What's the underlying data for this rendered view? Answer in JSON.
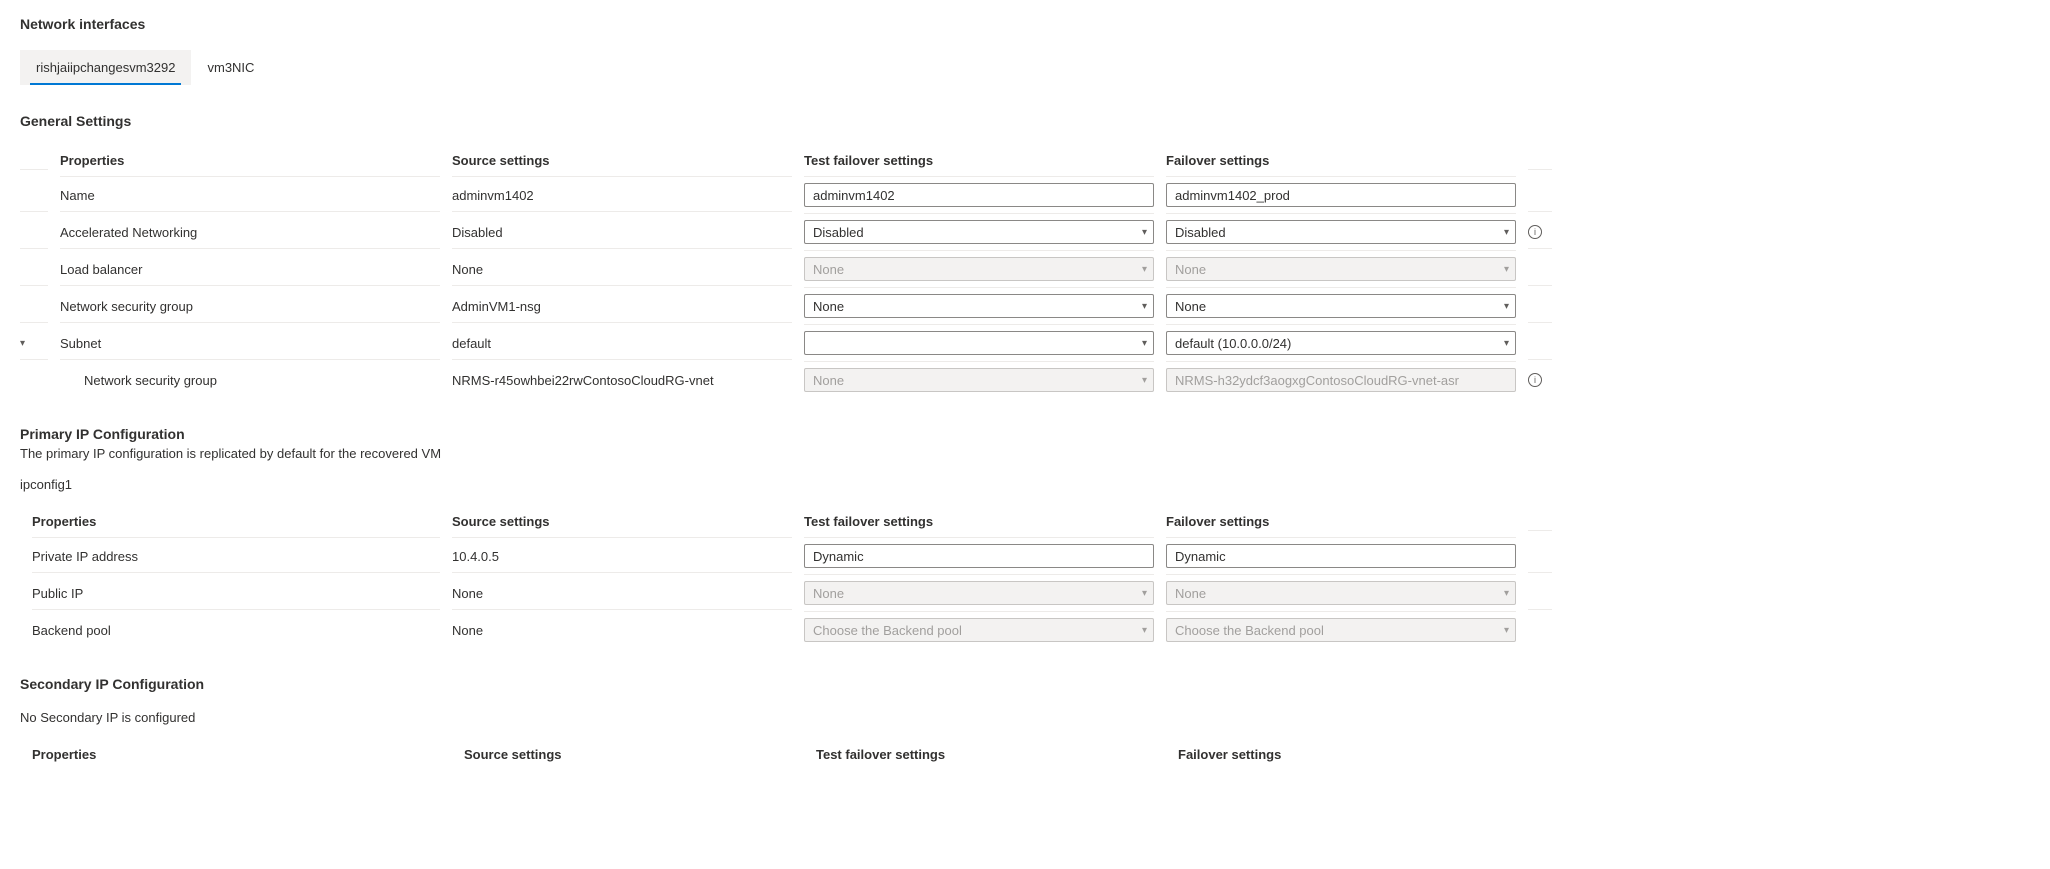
{
  "pageTitle": "Network interfaces",
  "tabs": [
    {
      "label": "rishjaiipchangesvm3292",
      "active": true
    },
    {
      "label": "vm3NIC",
      "active": false
    }
  ],
  "general": {
    "title": "General Settings",
    "headers": {
      "properties": "Properties",
      "source": "Source settings",
      "testFailover": "Test failover settings",
      "failover": "Failover settings"
    },
    "rows": {
      "name": {
        "label": "Name",
        "source": "adminvm1402",
        "test": "adminvm1402",
        "failover": "adminvm1402_prod"
      },
      "accel": {
        "label": "Accelerated Networking",
        "source": "Disabled",
        "test": "Disabled",
        "failover": "Disabled"
      },
      "lb": {
        "label": "Load balancer",
        "source": "None",
        "test": "None",
        "failover": "None"
      },
      "nsg": {
        "label": "Network security group",
        "source": "AdminVM1-nsg",
        "test": "None",
        "failover": "None"
      },
      "subnet": {
        "label": "Subnet",
        "source": "default",
        "test": "",
        "failover": "default (10.0.0.0/24)"
      },
      "subnsg": {
        "label": "Network security group",
        "source": "NRMS-r45owhbei22rwContosoCloudRG-vnet",
        "test": "None",
        "failover": "NRMS-h32ydcf3aogxgContosoCloudRG-vnet-asr"
      }
    }
  },
  "primary": {
    "title": "Primary IP Configuration",
    "desc": "The primary IP configuration is replicated by default for the recovered VM",
    "name": "ipconfig1",
    "headers": {
      "properties": "Properties",
      "source": "Source settings",
      "testFailover": "Test failover settings",
      "failover": "Failover settings"
    },
    "rows": {
      "privateIp": {
        "label": "Private IP address",
        "source": "10.4.0.5",
        "test": "Dynamic",
        "failover": "Dynamic"
      },
      "publicIp": {
        "label": "Public IP",
        "source": "None",
        "test": "None",
        "failover": "None"
      },
      "backend": {
        "label": "Backend pool",
        "source": "None",
        "test": "Choose the Backend pool",
        "failover": "Choose the Backend pool"
      }
    }
  },
  "secondary": {
    "title": "Secondary IP Configuration",
    "msg": "No Secondary IP is configured",
    "headers": {
      "properties": "Properties",
      "source": "Source settings",
      "testFailover": "Test failover settings",
      "failover": "Failover settings"
    }
  }
}
